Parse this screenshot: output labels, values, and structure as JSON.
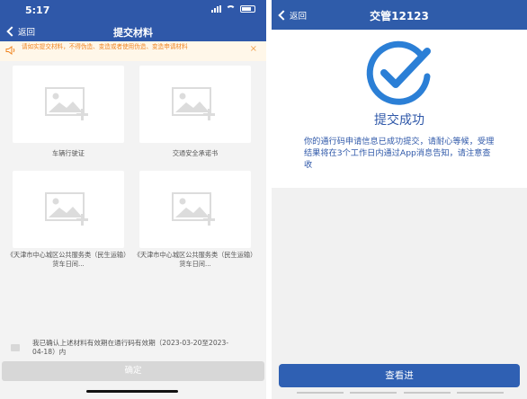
{
  "left": {
    "status": {
      "time": "5:17"
    },
    "header": {
      "back_label": "返回",
      "title": "提交材料"
    },
    "notice": {
      "text": "请如实提交材料，不得伪造、变造或者使用伪造、变造申请材料",
      "close": "×"
    },
    "uploads": [
      {
        "caption": "车辆行驶证"
      },
      {
        "caption": "交通安全承诺书"
      },
      {
        "caption": "《天津市中心城区公共服务类（民生运输）货车日间..."
      },
      {
        "caption": "《天津市中心城区公共服务类（民生运输）货车日间..."
      }
    ],
    "confirm": {
      "text": "我已确认上述材料有效期在通行码有效期（2023-03-20至2023-04-18）内"
    },
    "submit_label": "确定"
  },
  "right": {
    "header": {
      "back_label": "返回",
      "title": "交管12123"
    },
    "result": {
      "title": "提交成功",
      "message": "你的通行码申请信息已成功提交，请耐心等候，受理结果将在3个工作日内通过App消息告知，请注意查收"
    },
    "view_button_label": "查看进"
  },
  "colors": {
    "header_blue": "#2f58a9",
    "success_blue": "#2b7fd6",
    "notice_orange": "#f0841f",
    "notice_bg": "#fff7e9",
    "disabled_button": "#d7d7d7"
  },
  "icons": [
    "back-chevron-icon",
    "speaker-icon",
    "close-icon",
    "image-add-icon",
    "checkbox-icon",
    "check-circle-icon"
  ]
}
